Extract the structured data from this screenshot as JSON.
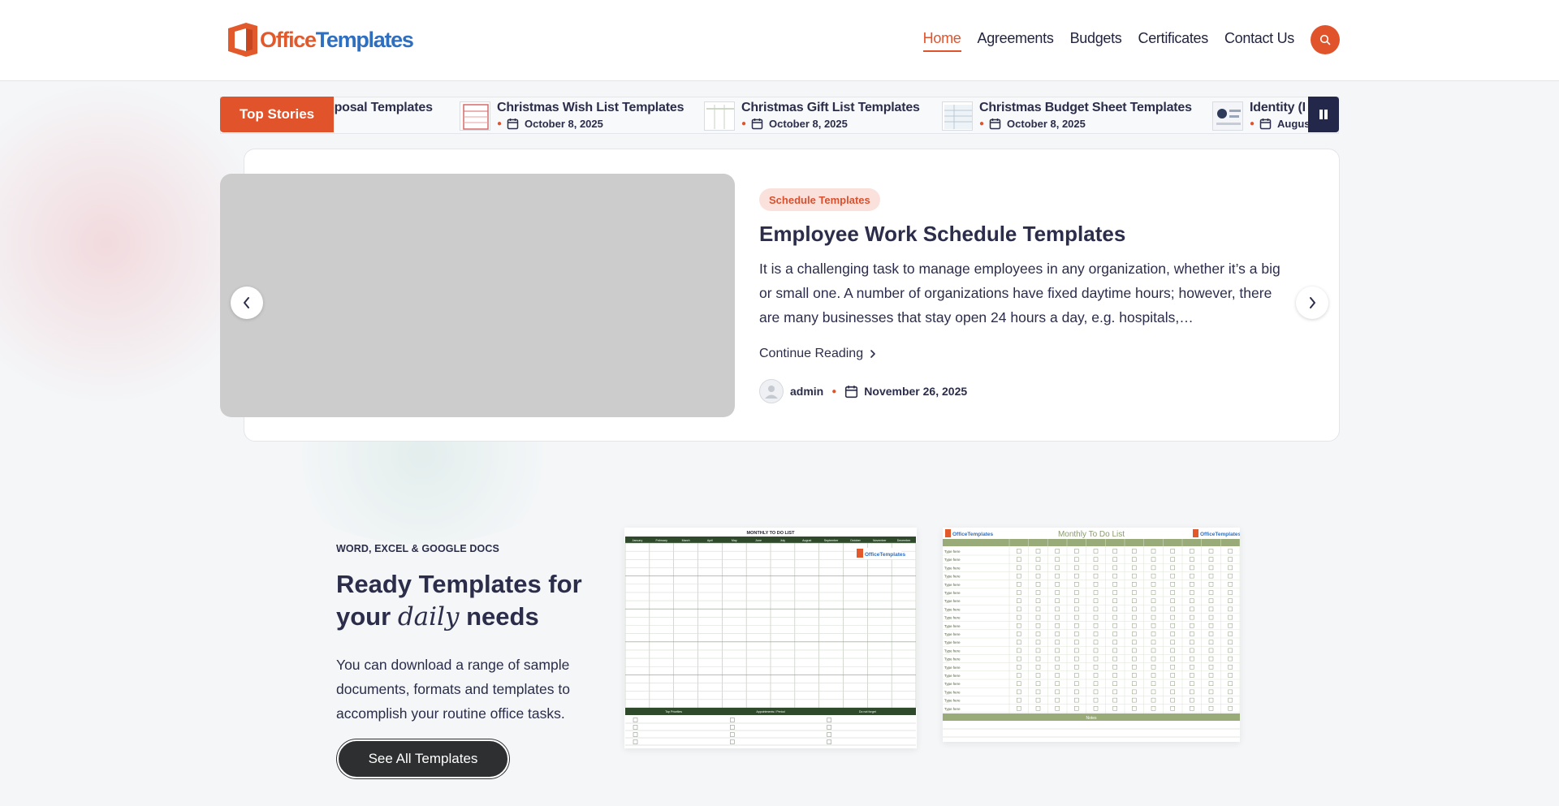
{
  "brand": {
    "logo_office": "Office",
    "logo_templates": "Templates",
    "accent_color": "#e0532b"
  },
  "nav": {
    "items": [
      {
        "label": "Home",
        "active": true
      },
      {
        "label": "Agreements",
        "active": false
      },
      {
        "label": "Budgets",
        "active": false
      },
      {
        "label": "Certificates",
        "active": false
      },
      {
        "label": "Contact Us",
        "active": false
      }
    ],
    "search_icon": "search-icon"
  },
  "ticker": {
    "label": "Top Stories",
    "pause_icon": "pause-icon",
    "items": [
      {
        "title": "oposal Templates",
        "date": ""
      },
      {
        "title": "Christmas Wish List Templates",
        "date": "October 8, 2025"
      },
      {
        "title": "Christmas Gift List Templates",
        "date": "October 8, 2025"
      },
      {
        "title": "Christmas Budget Sheet Templates",
        "date": "October 8, 2025"
      },
      {
        "title": "Identity (I",
        "date": "August"
      }
    ]
  },
  "featured": {
    "category": "Schedule Templates",
    "title": "Employee Work Schedule Templates",
    "excerpt": "It is a challenging task to manage employees in any organization, whether it’s a big or small one. A number of organizations have fixed daytime hours; however, there are many businesses that stay open 24 hours a day, e.g. hospitals,…",
    "continue_label": "Continue Reading",
    "author": "admin",
    "date": "November 26, 2025"
  },
  "promo": {
    "eyebrow": "WORD, EXCEL & GOOGLE DOCS",
    "heading_line1": "Ready Templates for",
    "heading_your": "your",
    "heading_daily": "daily",
    "heading_needs": "needs",
    "text": "You can download a range of sample documents, formats and templates to accomplish your routine office tasks.",
    "cta_label": "See All Templates",
    "sheet1_title": "MONTHLY TO DO LIST",
    "sheet1_months": [
      "January",
      "February",
      "March",
      "April",
      "May",
      "June",
      "July",
      "August",
      "September",
      "October",
      "November",
      "December"
    ],
    "sheet1_footer": [
      "Top Priorities",
      "Appointments / Period",
      "Do not forget"
    ],
    "sheet2_title": "Monthly To Do List",
    "sheet2_row_label": "Type here",
    "sheet2_footer": "Notes"
  }
}
